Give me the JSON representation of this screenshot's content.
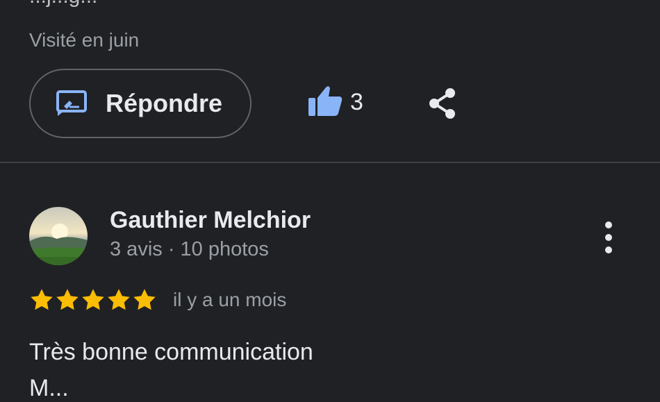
{
  "previous_review": {
    "cut_text": "...j...g...",
    "visited": "Visité en juin",
    "reply_label": "Répondre",
    "like_count": "3"
  },
  "review": {
    "author": "Gauthier Melchior",
    "meta": "3 avis · 10 photos",
    "rating": 5,
    "time": "il y a un mois",
    "text_line1": "Très bonne communication",
    "text_line2": "M..."
  },
  "colors": {
    "background": "#202124",
    "accent_blue": "#8ab4f8",
    "star": "#fbbc04"
  },
  "icons": {
    "reply": "reply-box-icon",
    "like": "thumbs-up-icon",
    "share": "share-icon",
    "more": "more-vert-icon",
    "star": "star-icon"
  }
}
